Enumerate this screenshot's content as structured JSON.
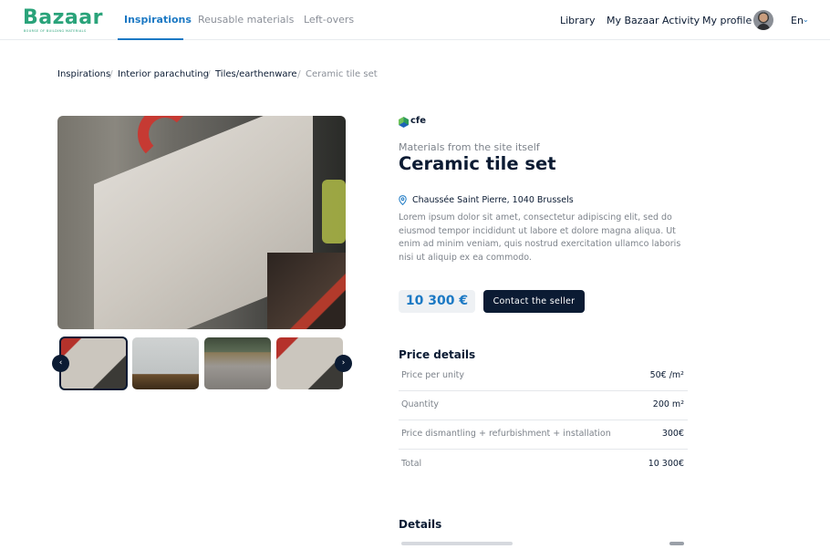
{
  "header": {
    "logo": {
      "word": "Bazaar",
      "tagline": "BOURSE OF BUILDING MATERIALS"
    },
    "tabs": [
      {
        "label": "Inspirations",
        "active": true
      },
      {
        "label": "Reusable materials",
        "active": false
      },
      {
        "label": "Left-overs",
        "active": false
      }
    ],
    "links": [
      "Library",
      "My Bazaar Activity",
      "My profile"
    ],
    "language": "En"
  },
  "breadcrumb": [
    "Inspirations",
    "Interior parachuting",
    "Tiles/earthenware",
    "Ceramic tile set"
  ],
  "gallery": {
    "thumbnails": [
      "thumbnail-1",
      "thumbnail-2",
      "thumbnail-3",
      "thumbnail-4"
    ],
    "prev_icon": "chevron-left-icon",
    "next_icon": "chevron-right-icon"
  },
  "product": {
    "brand": "cfe",
    "subtitle": "Materials from the site itself",
    "title": "Ceramic tile set",
    "address": "Chaussée Saint Pierre, 1040 Brussels",
    "description": "Lorem ipsum dolor sit amet, consectetur adipiscing elit, sed do eiusmod tempor incididunt ut labore et dolore magna aliqua. Ut enim ad minim veniam, quis nostrud exercitation ullamco laboris nisi ut aliquip ex ea commodo.",
    "price": "10 300 €",
    "contact_label": "Contact the seller"
  },
  "price_details": {
    "heading": "Price details",
    "rows": [
      {
        "label": "Price per unity",
        "value": "50€ /m²"
      },
      {
        "label": "Quantity",
        "value": "200 m²"
      },
      {
        "label": "Price dismantling + refurbishment + installation",
        "value": "300€"
      },
      {
        "label": "Total",
        "value": "10 300€"
      }
    ]
  },
  "details": {
    "heading": "Details"
  },
  "colors": {
    "accent": "#1c79c4",
    "navy": "#0b1b33",
    "brand_green": "#2aa37a"
  }
}
